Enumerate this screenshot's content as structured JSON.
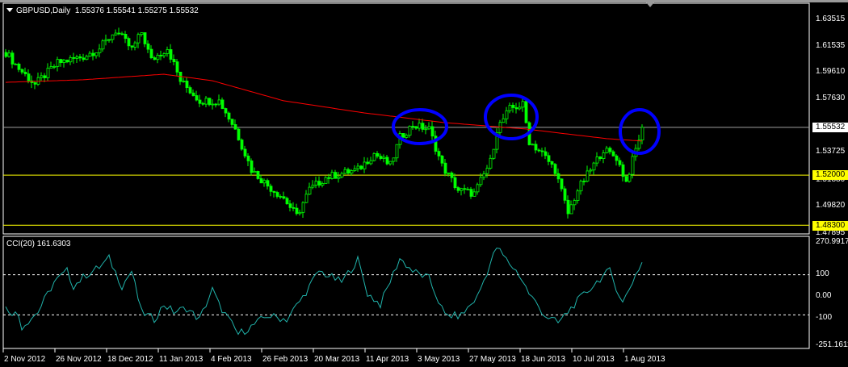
{
  "header": {
    "symbol_timeframe": "GBPUSD,Daily",
    "ohlc": "1.55376 1.55541 1.55275 1.55532"
  },
  "indicator": {
    "label": "CCI(20) 161.6303"
  },
  "colors": {
    "candle": "#00ff00",
    "ma": "#ff0000",
    "cci": "#20b2aa",
    "hline_yellow": "#ffff00",
    "current_line": "#a0a0a0",
    "circle": "#0000ff"
  },
  "price_scale": {
    "labels": [
      "1.63515",
      "1.61535",
      "1.59610",
      "1.57630",
      "1.53725",
      "1.51880",
      "1.49820",
      "1.47895"
    ]
  },
  "price_tags": {
    "current": "1.55532",
    "level1": "1.52000",
    "level2": "1.48300"
  },
  "cci_scale": {
    "labels": [
      "270.9917",
      "100",
      "0.00",
      "-100",
      "-251.1611"
    ]
  },
  "time_axis": {
    "labels": [
      "2 Nov 2012",
      "26 Nov 2012",
      "18 Dec 2012",
      "11 Jan 2013",
      "4 Feb 2013",
      "26 Feb 2013",
      "20 Mar 2013",
      "11 Apr 2013",
      "3 May 2013",
      "27 May 2013",
      "18 Jun 2013",
      "10 Jul 2013",
      "1 Aug 2013"
    ]
  },
  "chart_data": {
    "type": "candlestick",
    "symbol": "GBPUSD",
    "price_range": [
      1.47895,
      1.63515
    ],
    "bars": 198,
    "close_keypoints": [
      [
        0,
        1.6107
      ],
      [
        4,
        1.5988
      ],
      [
        9,
        1.587
      ],
      [
        16,
        1.603
      ],
      [
        24,
        1.6077
      ],
      [
        29,
        1.6137
      ],
      [
        34,
        1.6268
      ],
      [
        39,
        1.613
      ],
      [
        42,
        1.6256
      ],
      [
        45,
        1.605
      ],
      [
        50,
        1.614
      ],
      [
        54,
        1.5898
      ],
      [
        60,
        1.575
      ],
      [
        66,
        1.575
      ],
      [
        71,
        1.554
      ],
      [
        76,
        1.524
      ],
      [
        81,
        1.5123
      ],
      [
        86,
        1.503
      ],
      [
        90,
        1.4897
      ],
      [
        94,
        1.5094
      ],
      [
        99,
        1.5183
      ],
      [
        104,
        1.5213
      ],
      [
        109,
        1.524
      ],
      [
        114,
        1.536
      ],
      [
        119,
        1.5272
      ],
      [
        122,
        1.548
      ],
      [
        126,
        1.557
      ],
      [
        131,
        1.554
      ],
      [
        135,
        1.527
      ],
      [
        140,
        1.509
      ],
      [
        145,
        1.5063
      ],
      [
        150,
        1.53
      ],
      [
        152,
        1.554
      ],
      [
        156,
        1.569
      ],
      [
        160,
        1.572
      ],
      [
        162,
        1.545
      ],
      [
        166,
        1.536
      ],
      [
        170,
        1.524
      ],
      [
        174,
        1.4915
      ],
      [
        177,
        1.509
      ],
      [
        181,
        1.524
      ],
      [
        185,
        1.539
      ],
      [
        189,
        1.533
      ],
      [
        192,
        1.515
      ],
      [
        195,
        1.539
      ],
      [
        197,
        1.5553
      ]
    ],
    "ma_keypoints": [
      [
        0,
        1.5886
      ],
      [
        24,
        1.5905
      ],
      [
        49,
        1.5946
      ],
      [
        64,
        1.5898
      ],
      [
        86,
        1.575
      ],
      [
        111,
        1.566
      ],
      [
        136,
        1.5588
      ],
      [
        161,
        1.5541
      ],
      [
        186,
        1.547
      ],
      [
        197,
        1.5452
      ]
    ],
    "horizontal_levels": [
      1.55532,
      1.52,
      1.483
    ],
    "cci": {
      "period": 20,
      "last": 161.6303,
      "range": [
        -251.1611,
        270.9917
      ],
      "levels": [
        100,
        -100
      ],
      "keypoints": [
        [
          0,
          -67
        ],
        [
          4,
          -104
        ],
        [
          5,
          -159
        ],
        [
          10,
          -85
        ],
        [
          15,
          63
        ],
        [
          19,
          118
        ],
        [
          21,
          44
        ],
        [
          25,
          100
        ],
        [
          29,
          137
        ],
        [
          32,
          181
        ],
        [
          36,
          44
        ],
        [
          39,
          118
        ],
        [
          42,
          -85
        ],
        [
          46,
          -122
        ],
        [
          49,
          -48
        ],
        [
          52,
          -85
        ],
        [
          56,
          -67
        ],
        [
          60,
          -122
        ],
        [
          64,
          26
        ],
        [
          66,
          -48
        ],
        [
          72,
          -196
        ],
        [
          76,
          -159
        ],
        [
          81,
          -104
        ],
        [
          87,
          -122
        ],
        [
          92,
          -11
        ],
        [
          97,
          118
        ],
        [
          104,
          63
        ],
        [
          109,
          174
        ],
        [
          112,
          7
        ],
        [
          116,
          -48
        ],
        [
          122,
          181
        ],
        [
          126,
          118
        ],
        [
          131,
          81
        ],
        [
          136,
          -104
        ],
        [
          141,
          -104
        ],
        [
          146,
          -11
        ],
        [
          152,
          237
        ],
        [
          155,
          174
        ],
        [
          159,
          100
        ],
        [
          162,
          7
        ],
        [
          167,
          -104
        ],
        [
          171,
          -141
        ],
        [
          176,
          -48
        ],
        [
          184,
          81
        ],
        [
          187,
          118
        ],
        [
          191,
          -41
        ],
        [
          195,
          100
        ],
        [
          197,
          161.6
        ]
      ]
    },
    "annotations": [
      "circle around May 2013 high",
      "circle around June 2013 high",
      "circle around Aug 2013 current price"
    ]
  }
}
